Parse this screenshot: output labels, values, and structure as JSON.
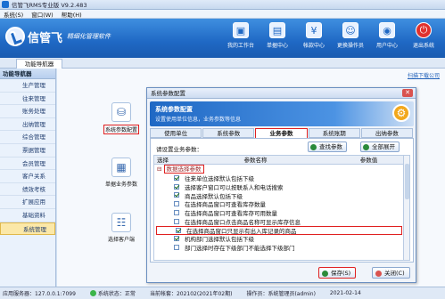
{
  "window": {
    "title": "信管飞RMS专业版 V9.2.483"
  },
  "menu": [
    "系统(S)",
    "窗口(W)",
    "帮助(H)"
  ],
  "brand": {
    "name": "信管飞",
    "tagline": "精细化管理软件"
  },
  "toolbar": [
    {
      "label": "我的工作台",
      "icon": "desktop-icon"
    },
    {
      "label": "单据中心",
      "icon": "document-icon"
    },
    {
      "label": "帐款中心",
      "icon": "money-icon"
    },
    {
      "label": "更换操作员",
      "icon": "user-switch-icon"
    },
    {
      "label": "用户中心",
      "icon": "globe-icon"
    },
    {
      "label": "退出系统",
      "icon": "power-icon"
    }
  ],
  "tabs": {
    "active": "功能导航器"
  },
  "nav": {
    "header": "功能导航器",
    "items": [
      "生产管理",
      "往来管理",
      "账务处理",
      "出纳管理",
      "综合管理",
      "票据管理",
      "会员管理",
      "客户关系",
      "绩效考核",
      "扩展应用",
      "基础资料",
      "系统管理"
    ],
    "active_index": 11
  },
  "workspace": {
    "link": "扫描下载公司",
    "icons": [
      {
        "label": "系统参数配置",
        "icon": "database-gear-icon"
      },
      {
        "label": "单据业务参数",
        "icon": "table-gear-icon"
      },
      {
        "label": "选择客户端",
        "icon": "clients-icon"
      }
    ]
  },
  "dialog": {
    "title": "系统参数配置",
    "header_title": "系统参数配置",
    "header_sub": "设置使用单位信息，业务参数等信息",
    "tabs": [
      "使用单位",
      "系统参数",
      "业务参数",
      "系统账期",
      "出纳参数"
    ],
    "active_tab": 2,
    "prompt": "请设置业务参数：",
    "find_btn": "查找参数",
    "expand_btn": "全部展开",
    "columns": [
      "选择",
      "参数名称",
      "参数值"
    ],
    "group": "数据选择参数",
    "rows": [
      {
        "label": "往来单位选择默认包括下级",
        "checked": true
      },
      {
        "label": "选择客户窗口可以按联系人和电话搜索",
        "checked": true
      },
      {
        "label": "商品选择默认包括下级",
        "checked": true
      },
      {
        "label": "在选择商品窗口可查看库存数量",
        "checked": false
      },
      {
        "label": "在选择商品窗口可查看库存可用数量",
        "checked": false
      },
      {
        "label": "在选择商品窗口点击商品名称可显示库存信息",
        "checked": false
      },
      {
        "label": "在选择商品窗口只显示有出入库记录的商品",
        "checked": true
      },
      {
        "label": "机构部门选择默认包括下级",
        "checked": true
      },
      {
        "label": "部门选择时存在下级部门不能选择下级部门",
        "checked": false
      }
    ],
    "highlight_row": 6,
    "save_btn": "保存(S)",
    "close_btn": "关闭(C)"
  },
  "status": {
    "server": "应用服务器：127.0.0.1:7099",
    "state": "系统状态：正常",
    "operator": "当前帐套：202102(2021年02期)",
    "user": "操作员：系统管理员(admin)",
    "date": "2021-02-14"
  }
}
